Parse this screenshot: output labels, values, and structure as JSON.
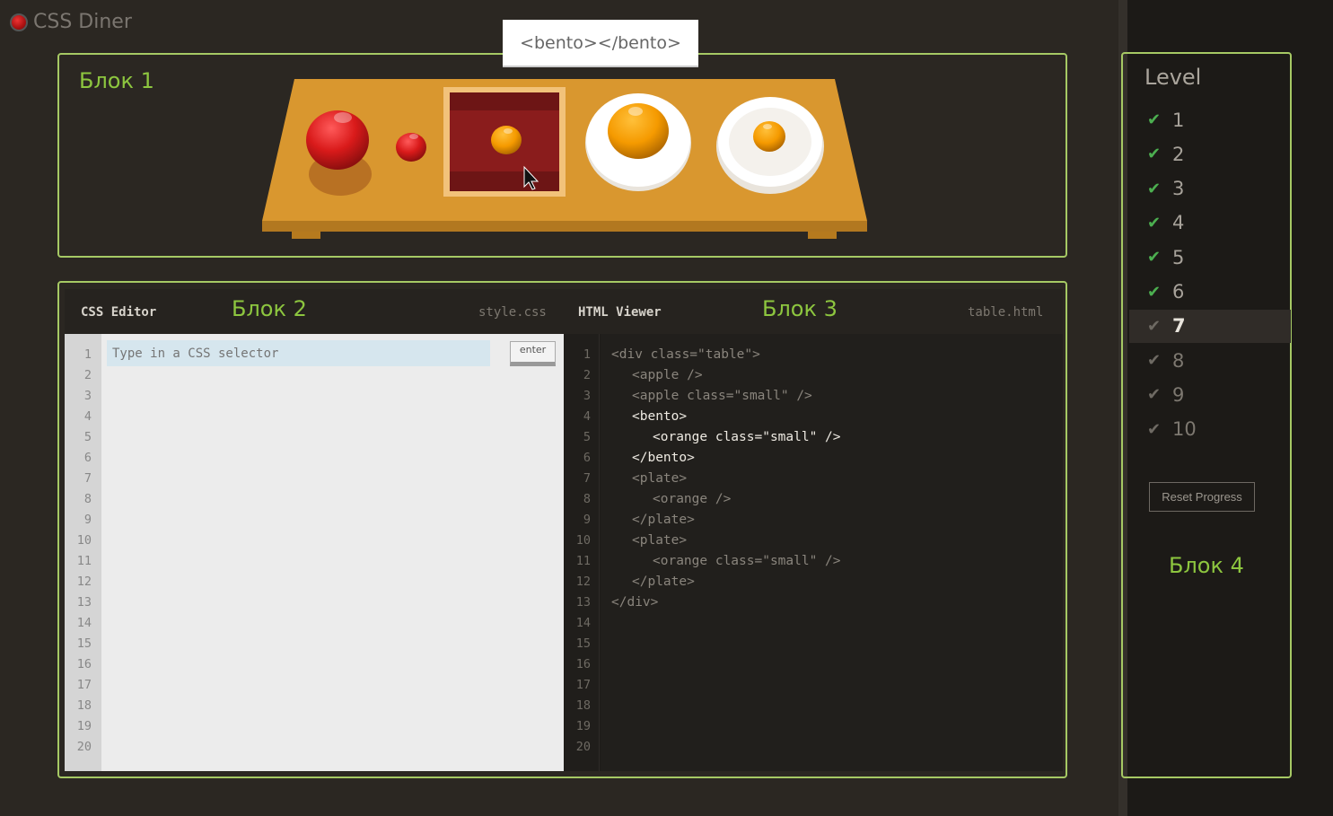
{
  "app": {
    "title": "CSS Diner"
  },
  "tooltip": {
    "text": "<bento></bento>"
  },
  "blocks": {
    "b1": "Блок 1",
    "b2": "Блок 2",
    "b3": "Блок 3",
    "b4": "Блок 4"
  },
  "css_editor": {
    "title": "CSS Editor",
    "filename": "style.css",
    "placeholder": "Type in a CSS selector",
    "enter_label": "enter",
    "line_numbers": [
      "1",
      "2",
      "3",
      "4",
      "5",
      "6",
      "7",
      "8",
      "9",
      "10",
      "11",
      "12",
      "13",
      "14",
      "15",
      "16",
      "17",
      "18",
      "19",
      "20"
    ]
  },
  "html_viewer": {
    "title": "HTML Viewer",
    "filename": "table.html",
    "line_numbers": [
      "1",
      "2",
      "3",
      "4",
      "5",
      "6",
      "7",
      "8",
      "9",
      "10",
      "11",
      "12",
      "13",
      "14",
      "15",
      "16",
      "17",
      "18",
      "19",
      "20"
    ],
    "code": [
      {
        "text": "<div class=\"table\">",
        "indent": 0,
        "hl": false
      },
      {
        "text": "<apple />",
        "indent": 1,
        "hl": false
      },
      {
        "text": "<apple class=\"small\" />",
        "indent": 1,
        "hl": false
      },
      {
        "text": "<bento>",
        "indent": 1,
        "hl": true
      },
      {
        "text": "<orange class=\"small\" />",
        "indent": 2,
        "hl": true
      },
      {
        "text": "</bento>",
        "indent": 1,
        "hl": true
      },
      {
        "text": "<plate>",
        "indent": 1,
        "hl": false
      },
      {
        "text": "<orange />",
        "indent": 2,
        "hl": false
      },
      {
        "text": "</plate>",
        "indent": 1,
        "hl": false
      },
      {
        "text": "<plate>",
        "indent": 1,
        "hl": false
      },
      {
        "text": "<orange class=\"small\" />",
        "indent": 2,
        "hl": false
      },
      {
        "text": "</plate>",
        "indent": 1,
        "hl": false
      },
      {
        "text": "</div>",
        "indent": 0,
        "hl": false
      }
    ]
  },
  "levels": {
    "title": "Level",
    "items": [
      {
        "num": "1",
        "done": true,
        "current": false
      },
      {
        "num": "2",
        "done": true,
        "current": false
      },
      {
        "num": "3",
        "done": true,
        "current": false
      },
      {
        "num": "4",
        "done": true,
        "current": false
      },
      {
        "num": "5",
        "done": true,
        "current": false
      },
      {
        "num": "6",
        "done": true,
        "current": false
      },
      {
        "num": "7",
        "done": false,
        "current": true
      },
      {
        "num": "8",
        "done": false,
        "current": false
      },
      {
        "num": "9",
        "done": false,
        "current": false
      },
      {
        "num": "10",
        "done": false,
        "current": false
      }
    ],
    "reset_label": "Reset Progress"
  },
  "colors": {
    "accent": "#8dc63f",
    "done_check": "#4caf50",
    "pending_check": "#6e6a63"
  }
}
